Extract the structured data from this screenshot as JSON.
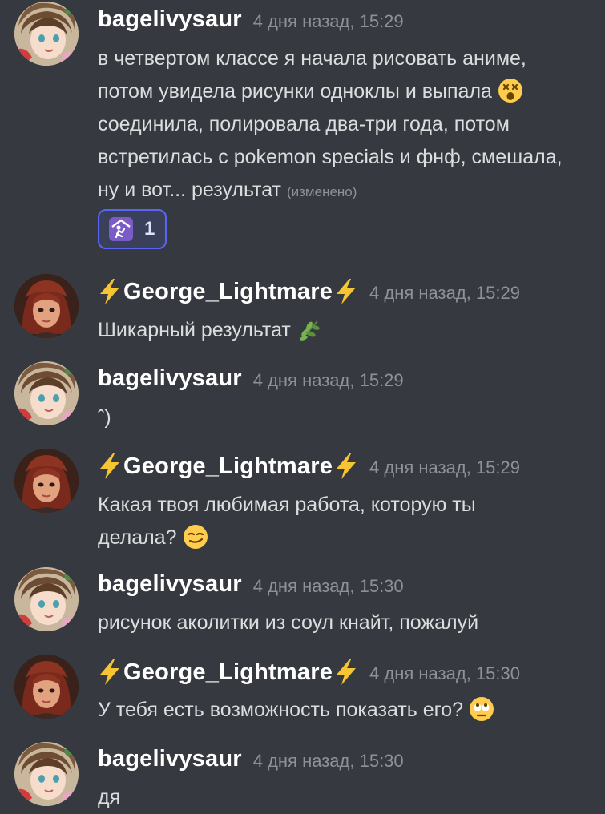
{
  "messages": [
    {
      "author": "bagelivysaur",
      "timestamp": "4 дня назад, 15:29",
      "lines": [
        "в четвертом классе я начала рисовать аниме,",
        "потом увидела рисунки одноклы и выпала",
        "соединила, полировала два-три года, потом",
        "встретилась с pokemon specials и фнф, смешала,",
        "ну и вот... результат"
      ],
      "edited": "(изменено)",
      "emoji_after_line_2": "dizzy-face-emoji",
      "reaction": {
        "icon": "praying-figure-icon",
        "count": "1"
      }
    },
    {
      "author": "George_Lightmare",
      "timestamp": "4 дня назад, 15:29",
      "text": "Шикарный результат",
      "emoji": "herb-emoji"
    },
    {
      "author": "bagelivysaur",
      "timestamp": "4 дня назад, 15:29",
      "text": "ˆ)"
    },
    {
      "author": "George_Lightmare",
      "timestamp": "4 дня назад, 15:29",
      "lines": [
        "Какая твоя любимая работа, которую ты",
        "делала?"
      ],
      "emoji": "smirking-face-emoji"
    },
    {
      "author": "bagelivysaur",
      "timestamp": "4 дня назад, 15:30",
      "text": "рисунок аколитки из соул кнайт, пожалуй"
    },
    {
      "author": "George_Lightmare",
      "timestamp": "4 дня назад, 15:30",
      "text": "У тебя есть возможность показать его?",
      "emoji": "rolling-eyes-emoji"
    },
    {
      "author": "bagelivysaur",
      "timestamp": "4 дня назад, 15:30",
      "text": "дя"
    }
  ],
  "colors": {
    "background": "#36393f",
    "username": "#ffffff",
    "text": "#dcddde",
    "muted": "#8e9297",
    "reaction_border": "#5865f2",
    "reaction_bg": "#3b405a",
    "bolt": "#f7c531"
  }
}
